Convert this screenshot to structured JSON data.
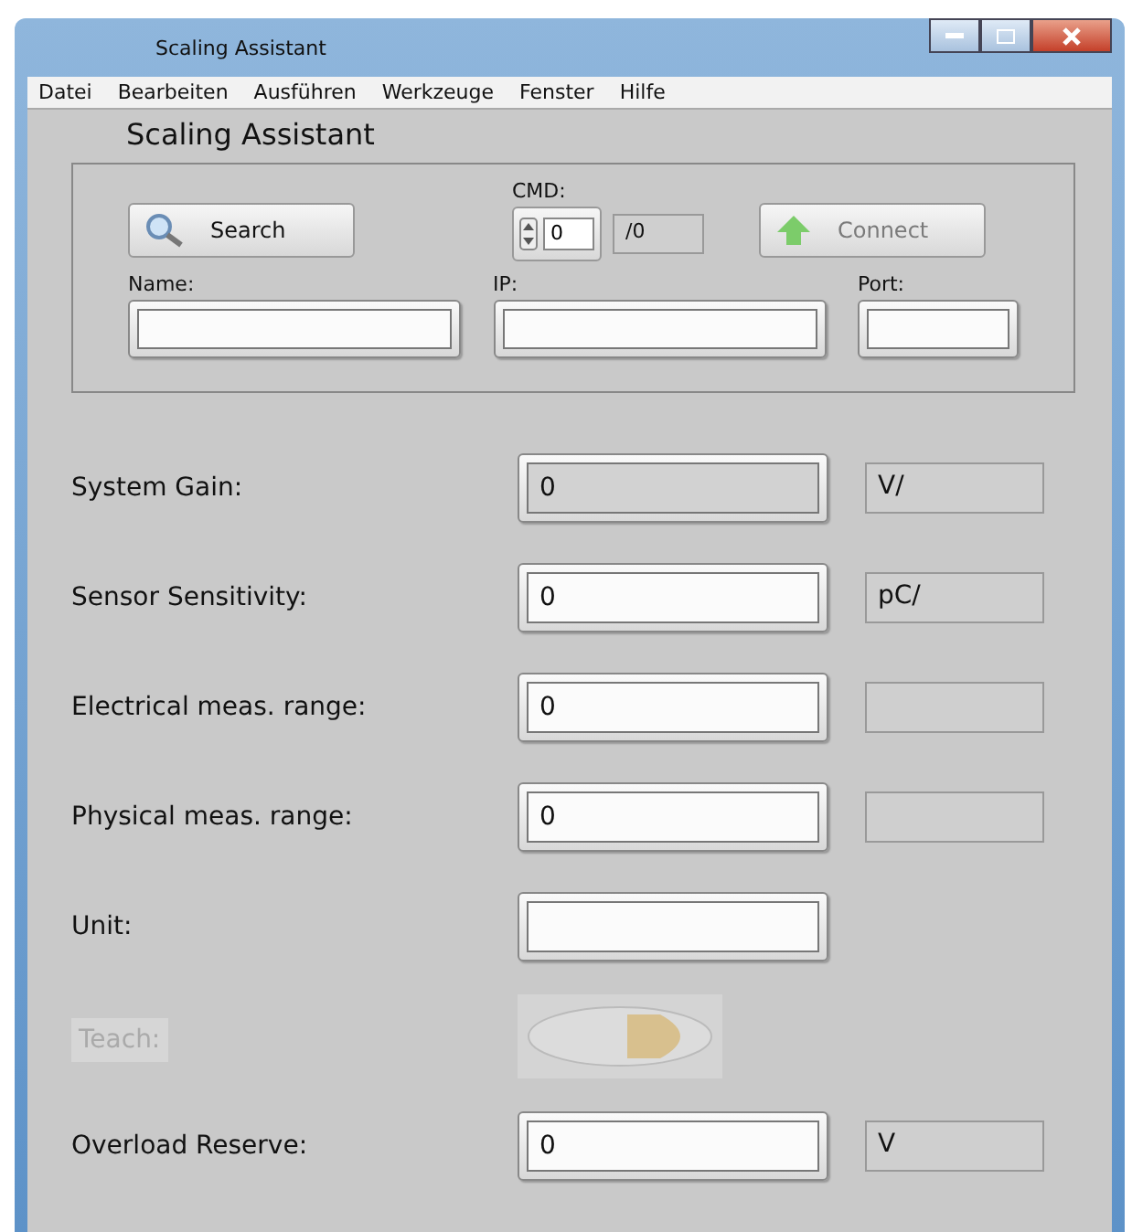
{
  "window": {
    "title": "Scaling Assistant"
  },
  "menu": [
    "Datei",
    "Bearbeiten",
    "Ausführen",
    "Werkzeuge",
    "Fenster",
    "Hilfe"
  ],
  "heading": "Scaling Assistant",
  "connection": {
    "search_button": "Search",
    "cmd_label": "CMD:",
    "cmd_value": "0",
    "cmd_total": "/0",
    "connect_button": {
      "label": "Connect",
      "disabled": true
    },
    "fields": [
      {
        "label": "Name:"
      },
      {
        "label": "IP:"
      },
      {
        "label": "Port:"
      }
    ]
  },
  "rows": [
    {
      "kind": "field",
      "label": "System Gain:",
      "value": "0",
      "readonly": true,
      "unit": "V/"
    },
    {
      "kind": "field",
      "label": "Sensor Sensitivity:",
      "value": "0",
      "readonly": false,
      "unit": "pC/"
    },
    {
      "kind": "field",
      "label": "Electrical meas. range:",
      "value": "0",
      "readonly": false,
      "unit": ""
    },
    {
      "kind": "field",
      "label": "Physical meas. range:",
      "value": "0",
      "readonly": false,
      "unit": ""
    },
    {
      "kind": "text",
      "label": "Unit:",
      "readonly": false
    },
    {
      "kind": "toggle",
      "label": "Teach:",
      "disabled": true,
      "on": false
    },
    {
      "kind": "field",
      "label": "Overload Reserve:",
      "value": "0",
      "readonly": false,
      "unit": "V"
    }
  ]
}
